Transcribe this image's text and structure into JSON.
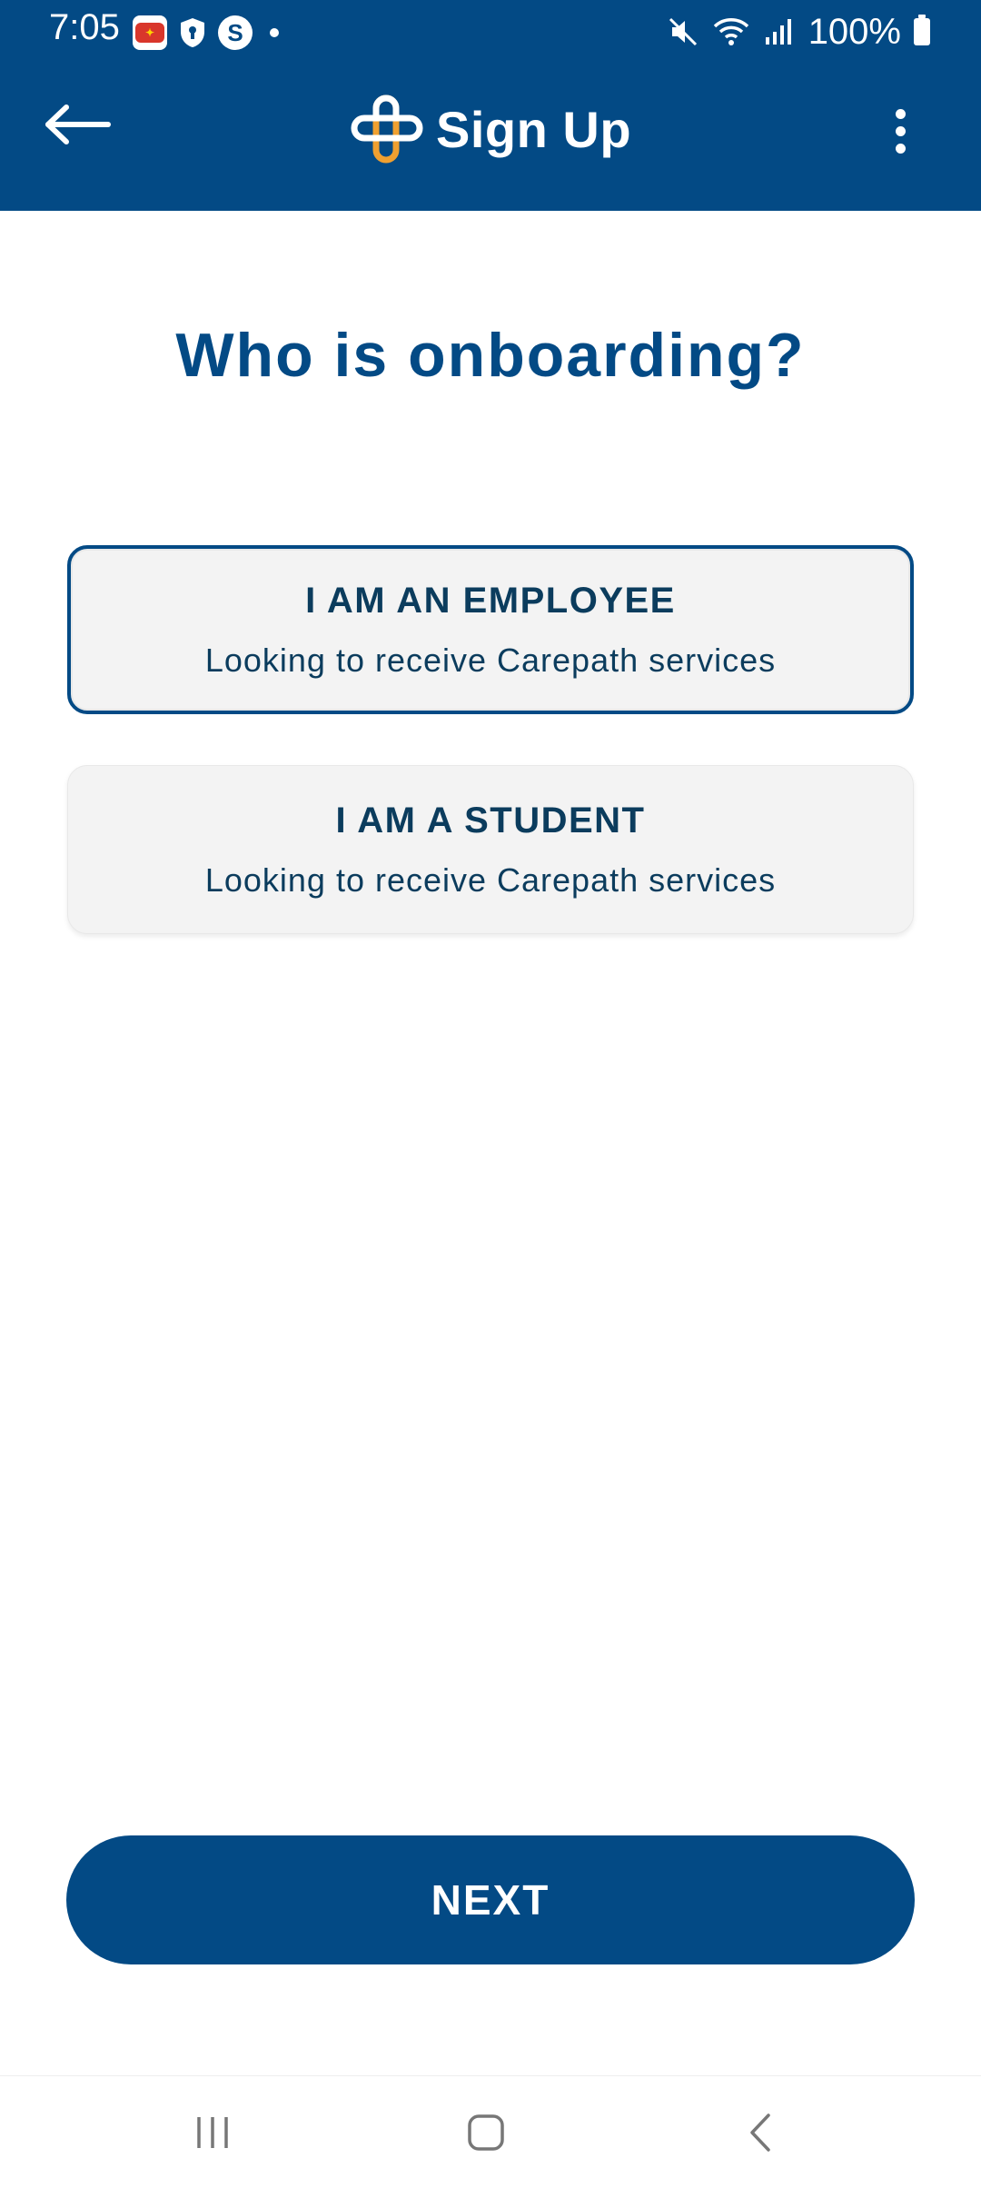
{
  "status_bar": {
    "time": "7:05",
    "battery": "100%",
    "icons": [
      "app-notification-icon",
      "shield-lock-icon",
      "s-app-icon",
      "dot-icon",
      "mute-icon",
      "wifi-icon",
      "signal-icon",
      "battery-icon"
    ]
  },
  "app_bar": {
    "title": "Sign Up",
    "back_icon": "arrow-left-icon",
    "menu_icon": "more-vert-icon",
    "logo": "carepath-logo"
  },
  "main": {
    "heading": "Who is onboarding?",
    "options": [
      {
        "title": "I AM AN EMPLOYEE",
        "subtitle": "Looking to receive Carepath services",
        "selected": true
      },
      {
        "title": "I AM A STUDENT",
        "subtitle": "Looking to receive Carepath services",
        "selected": false
      }
    ],
    "next_label": "NEXT"
  },
  "nav_bar": {
    "icons": [
      "recents-icon",
      "home-icon",
      "back-icon"
    ]
  },
  "colors": {
    "primary": "#034a85",
    "accent": "#f0a030",
    "text_dark": "#0b3c5d",
    "option_bg": "#f3f3f3"
  }
}
